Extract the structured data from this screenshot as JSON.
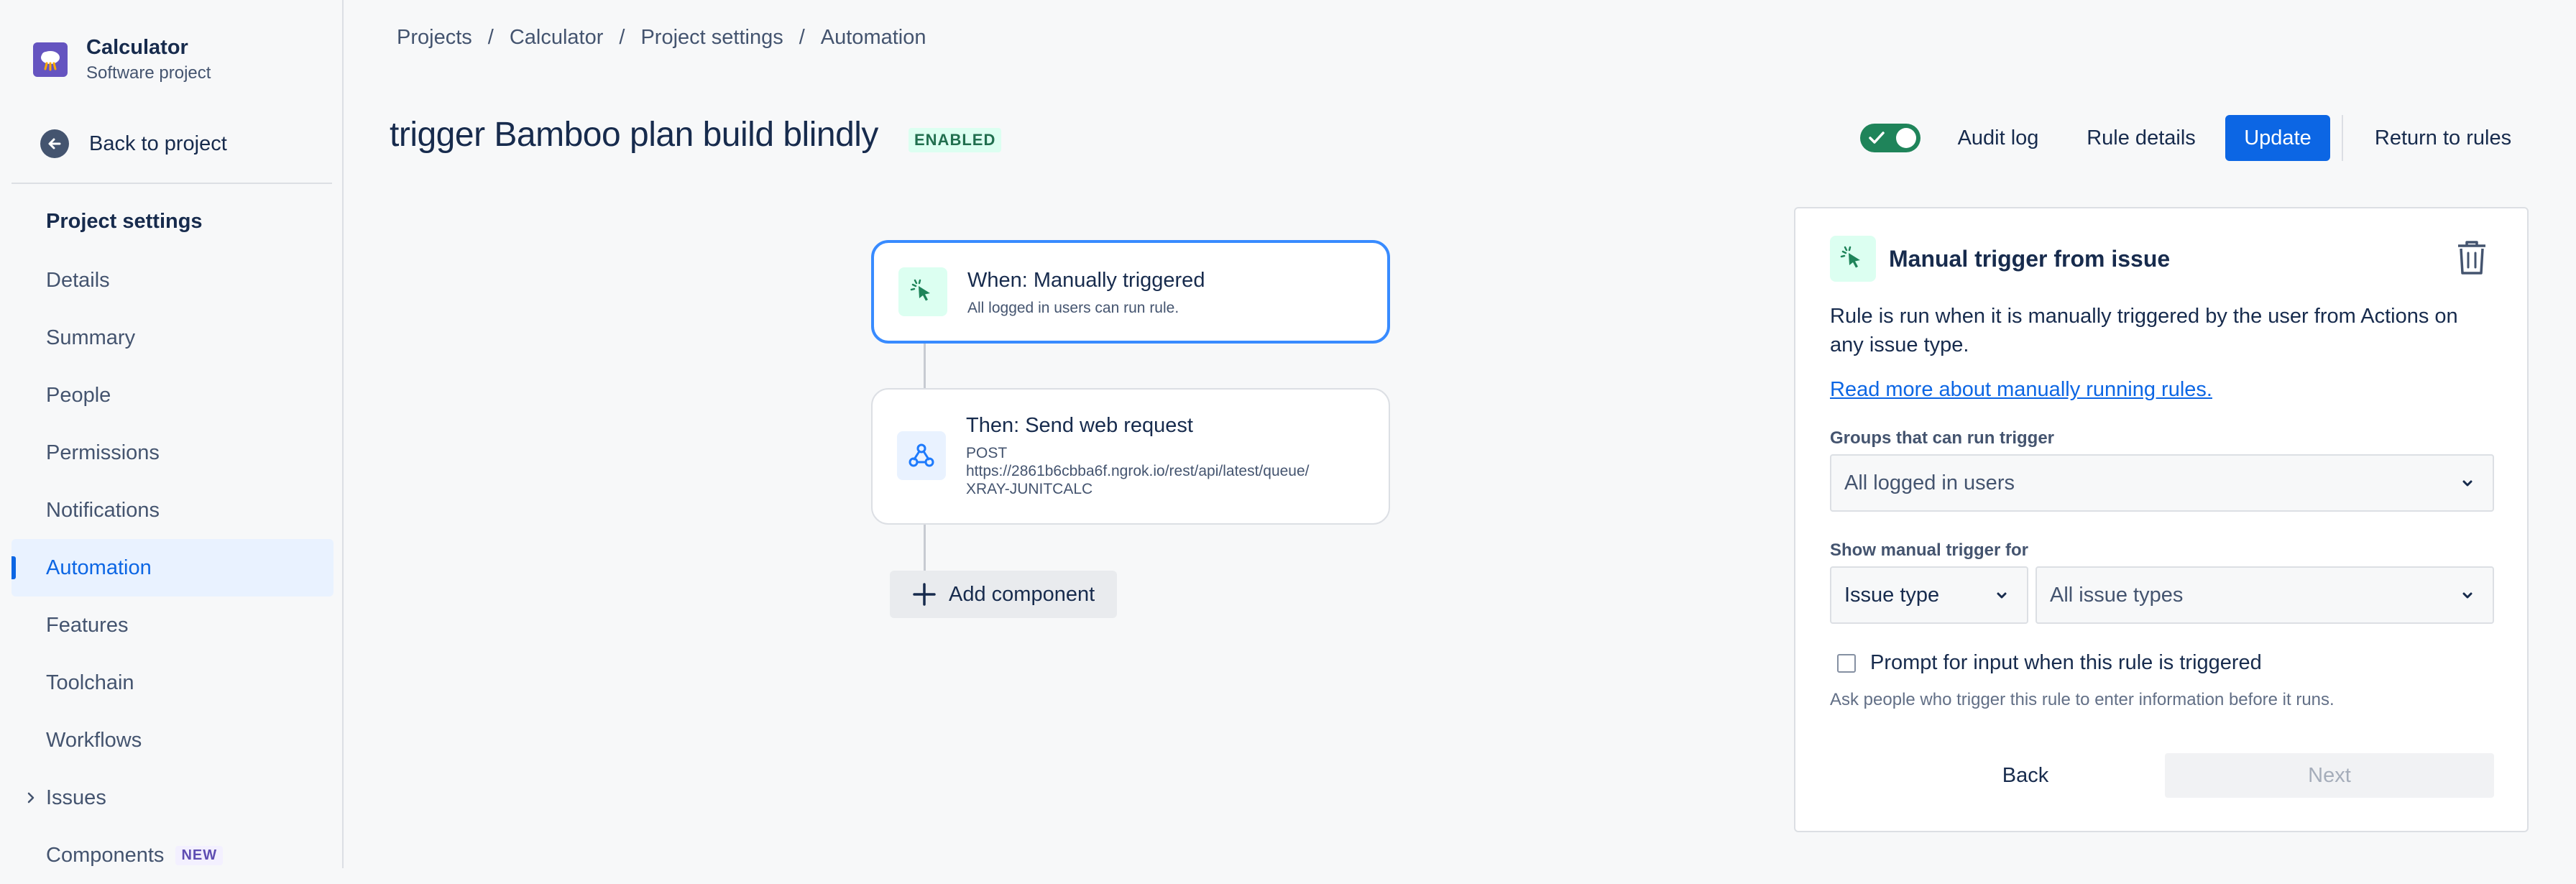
{
  "project": {
    "name": "Calculator",
    "type": "Software project"
  },
  "sidebar": {
    "back_label": "Back to project",
    "section_title": "Project settings",
    "items": [
      {
        "label": "Details"
      },
      {
        "label": "Summary"
      },
      {
        "label": "People"
      },
      {
        "label": "Permissions"
      },
      {
        "label": "Notifications"
      },
      {
        "label": "Automation",
        "active": true
      },
      {
        "label": "Features"
      },
      {
        "label": "Toolchain"
      },
      {
        "label": "Workflows"
      },
      {
        "label": "Issues",
        "expandable": true
      },
      {
        "label": "Components",
        "badge": "NEW"
      }
    ]
  },
  "breadcrumb": [
    "Projects",
    "Calculator",
    "Project settings",
    "Automation"
  ],
  "rule": {
    "title": "trigger Bamboo plan build blindly",
    "status": "ENABLED",
    "enabled": true
  },
  "toolbar": {
    "audit_log": "Audit log",
    "rule_details": "Rule details",
    "update": "Update",
    "return": "Return to rules"
  },
  "flow": {
    "trigger": {
      "title": "When: Manually triggered",
      "subtitle": "All logged in users can run rule."
    },
    "action": {
      "title": "Then: Send web request",
      "lines": [
        "POST",
        "https://2861b6cbba6f.ngrok.io/rest/api/latest/queue/",
        "XRAY-JUNITCALC"
      ]
    },
    "add_component": "Add component"
  },
  "panel": {
    "title": "Manual trigger from issue",
    "description": "Rule is run when it is manually triggered by the user from Actions on any issue type.",
    "link": "Read more about manually running rules.",
    "groups_label": "Groups that can run trigger",
    "groups_value": "All logged in users",
    "show_for_label": "Show manual trigger for",
    "show_for_type": "Issue type",
    "show_for_value": "All issue types",
    "prompt_label": "Prompt for input when this rule is triggered",
    "prompt_checked": false,
    "prompt_help": "Ask people who trigger this rule to enter information before it runs.",
    "back": "Back",
    "next": "Next"
  },
  "colors": {
    "primary": "#0C66E4",
    "success": "#1F845A",
    "selected_border": "#388BFF"
  }
}
